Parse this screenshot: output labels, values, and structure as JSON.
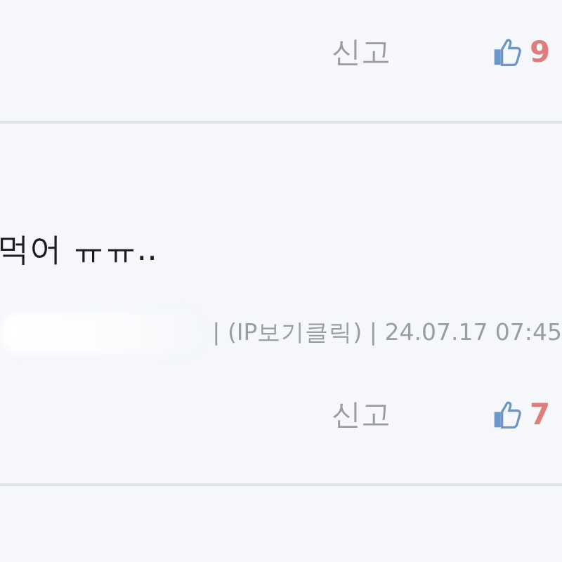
{
  "comments": [
    {
      "report_label": "신고",
      "like_count": "9"
    },
    {
      "body": "먹어 ㅠㅠ..",
      "meta": "| (IP보기클릭) | 24.07.17 07:45",
      "report_label": "신고",
      "like_count": "7"
    }
  ]
}
